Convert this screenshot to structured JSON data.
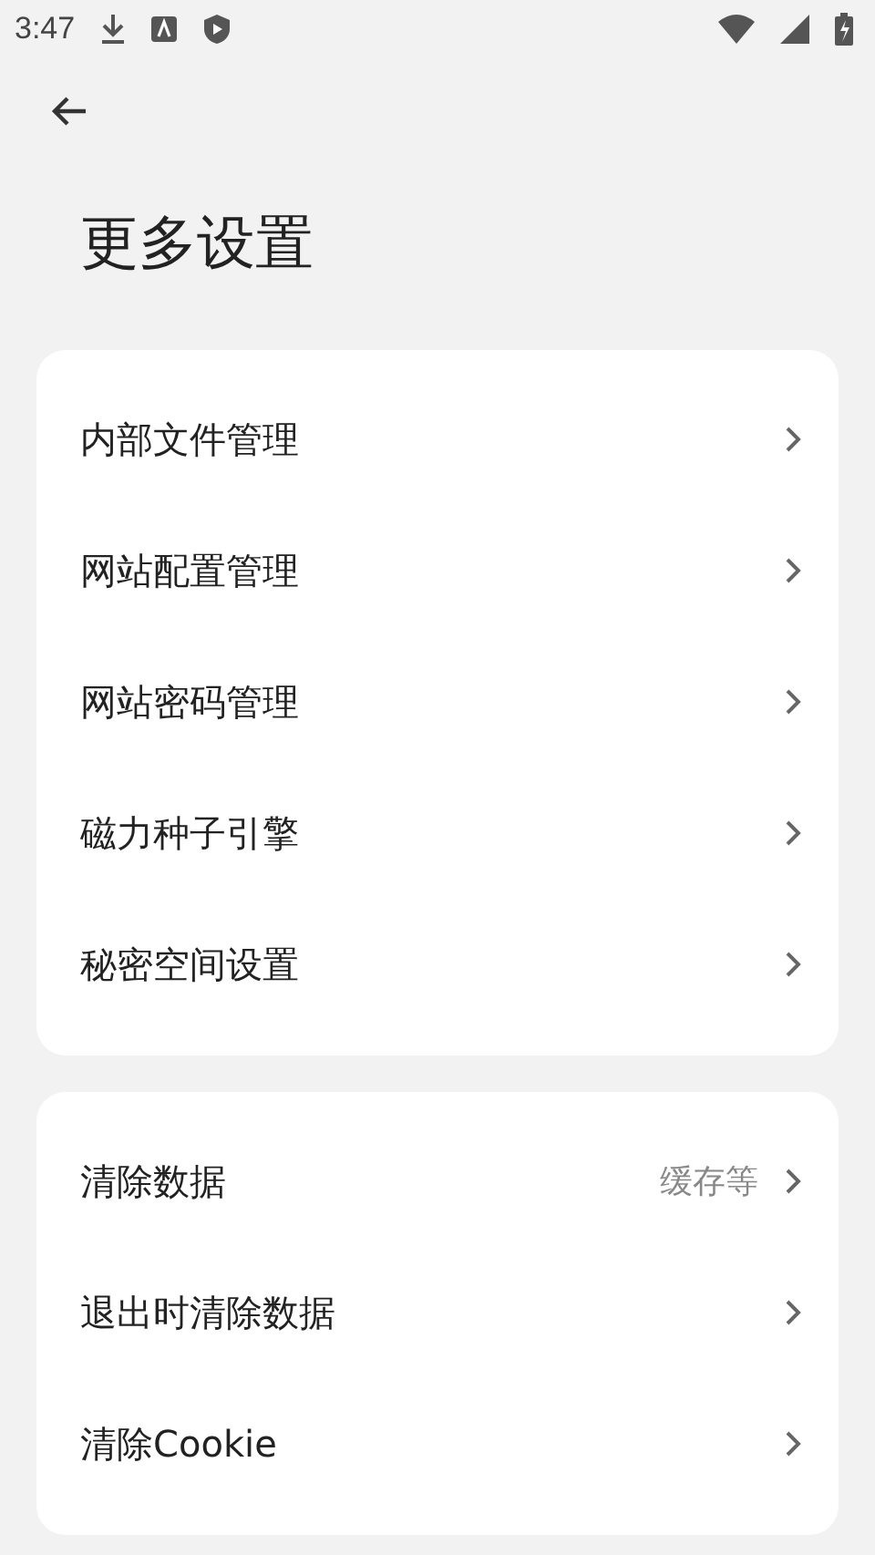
{
  "status_bar": {
    "time": "3:47"
  },
  "title": "更多设置",
  "groups": [
    {
      "items": [
        {
          "label": "内部文件管理"
        },
        {
          "label": "网站配置管理"
        },
        {
          "label": "网站密码管理"
        },
        {
          "label": "磁力种子引擎"
        },
        {
          "label": "秘密空间设置"
        }
      ]
    },
    {
      "items": [
        {
          "label": "清除数据",
          "value": "缓存等"
        },
        {
          "label": "退出时清除数据"
        },
        {
          "label": "清除Cookie"
        }
      ]
    }
  ]
}
